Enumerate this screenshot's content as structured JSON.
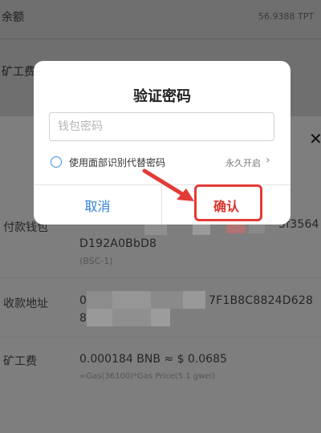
{
  "background": {
    "balance_label": "余额",
    "balance_value": "56.9388 TPT",
    "miner_fee_label": "矿工费"
  },
  "sheet": {
    "close_symbol": "✕",
    "payment_wallet_label": "付款钱包",
    "payment_wallet_addr_tail": "5f3564",
    "payment_wallet_addr_line2": "D192A0BbD8",
    "chain": "(BSC-1)",
    "receive_address_label": "收款地址",
    "receive_address_head": "0",
    "receive_address_tail": "7F1B8C8824D628",
    "receive_address_line2": "8",
    "fee_label": "矿工费",
    "fee_value": "0.000184 BNB ≈ $ 0.0685",
    "fee_formula": "=Gas(36100)*Gas Price(5.1 gwei)"
  },
  "dialog": {
    "title": "验证密码",
    "password_placeholder": "钱包密码",
    "password_value": "",
    "face_id_option": "使用面部识别代替密码",
    "always_on": "永久开启",
    "chevron": "›",
    "cancel_label": "取消",
    "confirm_label": "确认"
  },
  "colors": {
    "accent_blue": "#2f7fd8",
    "confirm_red": "#d9352d",
    "annotation_red": "#e23b36"
  }
}
